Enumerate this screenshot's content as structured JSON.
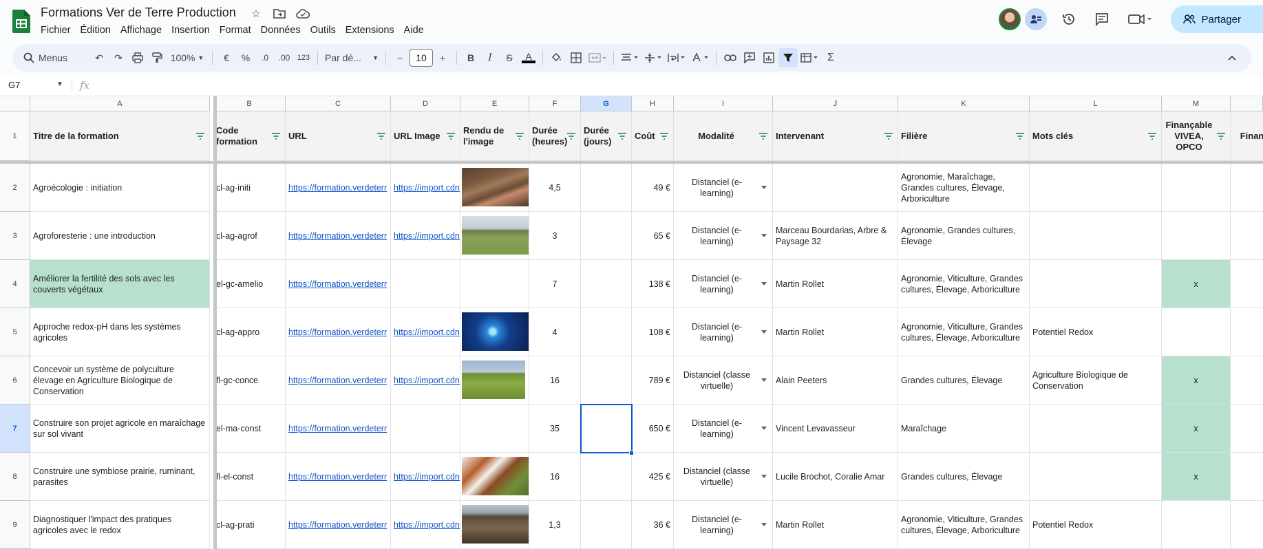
{
  "app": {
    "doc_title": "Formations Ver de Terre Production",
    "menu": [
      "Fichier",
      "Édition",
      "Affichage",
      "Insertion",
      "Format",
      "Données",
      "Outils",
      "Extensions",
      "Aide"
    ],
    "share_label": "Partager",
    "brand_color": "#188038"
  },
  "toolbar": {
    "search_label": "Menus",
    "zoom": "100%",
    "currency": "€",
    "percent": "%",
    "dec_decrease": ".0",
    "dec_increase": ".00",
    "number_format": "123",
    "font_name": "Par dé...",
    "font_size": "10",
    "bold": "B",
    "italic": "I",
    "strike": "S",
    "text_color": "A",
    "sum": "Σ"
  },
  "formula_bar": {
    "name_box": "G7",
    "fx": "fx",
    "value": ""
  },
  "columns": [
    "A",
    "B",
    "C",
    "D",
    "E",
    "F",
    "G",
    "H",
    "I",
    "J",
    "K",
    "L",
    "M",
    ""
  ],
  "rows": [
    "1",
    "2",
    "3",
    "4",
    "5",
    "6",
    "7",
    "8",
    "9"
  ],
  "headers": [
    "Titre de la formation",
    "Code formation",
    "URL",
    "URL Image",
    "Rendu de l'image",
    "Durée (heures)",
    "Durée (jours)",
    "Coût",
    "Modalité",
    "Intervenant",
    "Filière",
    "Mots clés",
    "Finançable VIVEA, OPCO",
    "Finanç CP"
  ],
  "data": [
    {
      "title": "Agroécologie : initiation",
      "code": "cl-ag-initi",
      "url": "https://formation.verdeterr",
      "img_url": "https://import.cdn",
      "img": "worms",
      "hours": "4,5",
      "days": "",
      "cost": "49 €",
      "mode": "Distanciel (e-learning)",
      "speaker": "",
      "sector": "Agronomie, Maraîchage, Grandes cultures, Élevage, Arboriculture",
      "keywords": "",
      "fin": ""
    },
    {
      "title": "Agroforesterie : une introduction",
      "code": "cl-ag-agrof",
      "url": "https://formation.verdeterr",
      "img_url": "https://import.cdn",
      "img": "field",
      "hours": "3",
      "days": "",
      "cost": "65 €",
      "mode": "Distanciel (e-learning)",
      "speaker": "Marceau Bourdarias, Arbre & Paysage 32",
      "sector": "Agronomie, Grandes cultures, Élevage",
      "keywords": "",
      "fin": ""
    },
    {
      "title": "Améliorer la fertilité des sols avec les couverts végétaux",
      "code": "el-gc-amelio",
      "url": "https://formation.verdeterr",
      "img_url": "",
      "img": "",
      "hours": "7",
      "days": "",
      "cost": "138 €",
      "mode": "Distanciel (e-learning)",
      "speaker": "Martin Rollet",
      "sector": "Agronomie, Viticulture, Grandes cultures, Élevage, Arboriculture",
      "keywords": "",
      "fin": "x"
    },
    {
      "title": "Approche redox-pH dans les systèmes agricoles",
      "code": "cl-ag-appro",
      "url": "https://formation.verdeterr",
      "img_url": "https://import.cdn",
      "img": "atom",
      "hours": "4",
      "days": "",
      "cost": "108 €",
      "mode": "Distanciel (e-learning)",
      "speaker": "Martin Rollet",
      "sector": "Agronomie, Viticulture, Grandes cultures, Élevage, Arboriculture",
      "keywords": "Potentiel Redox",
      "fin": ""
    },
    {
      "title": "Concevoir un système de polyculture élevage en Agriculture Biologique de Conservation",
      "code": "fl-gc-conce",
      "url": "https://formation.verdeterr",
      "img_url": "https://import.cdn",
      "img": "tractor",
      "hours": "16",
      "days": "",
      "cost": "789 €",
      "mode": "Distanciel (classe virtuelle)",
      "speaker": "Alain Peeters",
      "sector": "Grandes cultures, Élevage",
      "keywords": "Agriculture Biologique de Conservation",
      "fin": "x"
    },
    {
      "title": "Construire son projet agricole en maraîchage sur sol vivant",
      "code": "el-ma-const",
      "url": "https://formation.verdeterr",
      "img_url": "",
      "img": "",
      "hours": "35",
      "days": "",
      "cost": "650 €",
      "mode": "Distanciel (e-learning)",
      "speaker": "Vincent Levavasseur",
      "sector": "Maraîchage",
      "keywords": "",
      "fin": "x"
    },
    {
      "title": "Construire une symbiose prairie, ruminant, parasites",
      "code": "fl-el-const",
      "url": "https://formation.verdeterr",
      "img_url": "https://import.cdn",
      "img": "cows",
      "hours": "16",
      "days": "",
      "cost": "425 €",
      "mode": "Distanciel (classe virtuelle)",
      "speaker": "Lucile Brochot, Coralie Amar",
      "sector": "Grandes cultures, Élevage",
      "keywords": "",
      "fin": "x"
    },
    {
      "title": "Diagnostiquer l'impact des pratiques agricoles avec le redox",
      "code": "cl-ag-prati",
      "url": "https://formation.verdeterr",
      "img_url": "https://import.cdn",
      "img": "soil",
      "hours": "1,3",
      "days": "",
      "cost": "36 €",
      "mode": "Distanciel (e-learning)",
      "speaker": "Martin Rollet",
      "sector": "Agronomie, Viticulture, Grandes cultures, Élevage, Arboriculture",
      "keywords": "Potentiel Redox",
      "fin": ""
    }
  ],
  "colors": {
    "selection": "#0b57d0",
    "highlight_green": "#b7e1cd",
    "link": "#1155cc",
    "share_bg": "#c2e7ff"
  }
}
